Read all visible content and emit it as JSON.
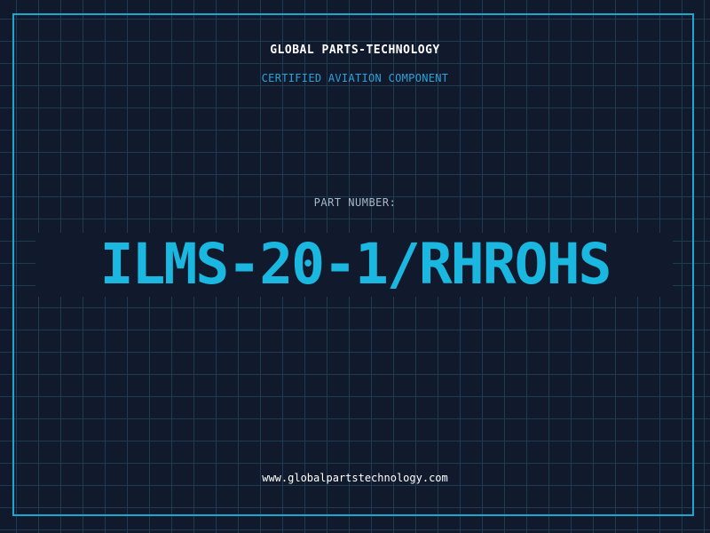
{
  "header": {
    "brand": "GLOBAL PARTS-TECHNOLOGY",
    "subtitle": "CERTIFIED AVIATION COMPONENT"
  },
  "part": {
    "label": "PART NUMBER:",
    "number": "ILMS-20-1/RHROHS"
  },
  "footer": {
    "url": "www.globalpartstechnology.com"
  },
  "colors": {
    "background": "#111a2c",
    "grid": "#1f3b52",
    "frame": "#1aa8cf",
    "accent": "#1ab8e0",
    "subtitle": "#2aa3d8",
    "label": "#a9b8c8",
    "text": "#ffffff"
  }
}
